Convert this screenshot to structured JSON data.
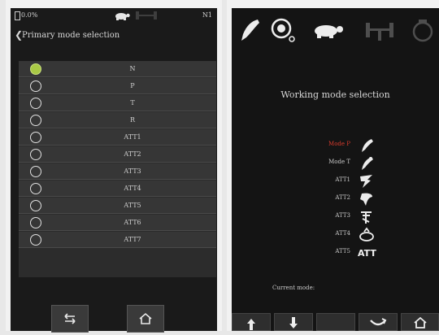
{
  "left": {
    "status": {
      "battery": "0.0%",
      "mode_badge": "N1"
    },
    "title": "Primary mode selection",
    "modes": [
      {
        "label": "N",
        "selected": true
      },
      {
        "label": "P",
        "selected": false
      },
      {
        "label": "T",
        "selected": false
      },
      {
        "label": "R",
        "selected": false
      },
      {
        "label": "ATT1",
        "selected": false
      },
      {
        "label": "ATT2",
        "selected": false
      },
      {
        "label": "ATT3",
        "selected": false
      },
      {
        "label": "ATT4",
        "selected": false
      },
      {
        "label": "ATT5",
        "selected": false
      },
      {
        "label": "ATT6",
        "selected": false
      },
      {
        "label": "ATT7",
        "selected": false
      }
    ],
    "nav": {
      "back_icon": "return-icon",
      "home_icon": "home-icon"
    }
  },
  "right": {
    "top_icons": [
      "tooth-icon",
      "pressure-gauge-icon",
      "turtle-icon",
      "gripper-icon",
      "motor-icon"
    ],
    "title": "Working mode selection",
    "modes": [
      {
        "label": "Mode P",
        "active": true,
        "icon": "handpiece-p-icon"
      },
      {
        "label": "Mode T",
        "active": false,
        "icon": "handpiece-t-icon"
      },
      {
        "label": "ATT1",
        "active": false,
        "icon": "att1-icon"
      },
      {
        "label": "ATT2",
        "active": false,
        "icon": "att2-icon"
      },
      {
        "label": "ATT3",
        "active": false,
        "icon": "att3-icon"
      },
      {
        "label": "ATT4",
        "active": false,
        "icon": "att4-icon"
      },
      {
        "label": "ATT5",
        "active": false,
        "icon": "att5-text"
      }
    ],
    "att5_text": "ATT",
    "current_label": "Current mode:",
    "bottom_icons": [
      "arrow-up-icon",
      "arrow-down-icon",
      "blank-button",
      "confirm-icon",
      "home-icon"
    ],
    "accent_active": "#d63a2c",
    "accent_selected": "#a9c945"
  }
}
